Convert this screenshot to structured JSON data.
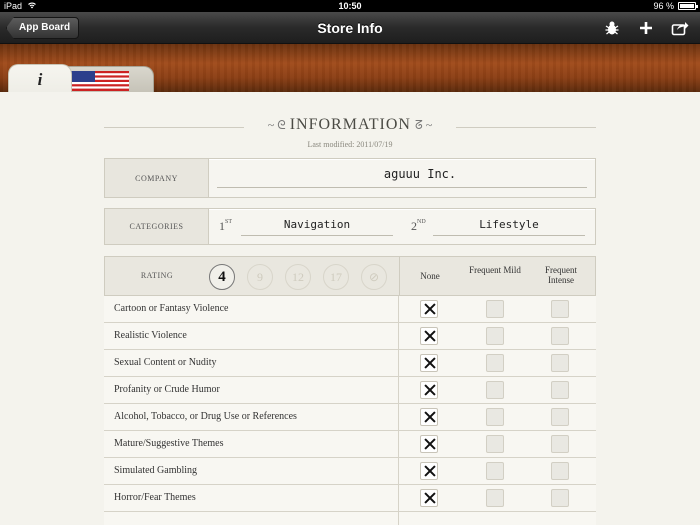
{
  "status_bar": {
    "device": "iPad",
    "time": "10:50",
    "battery": "96 %"
  },
  "nav": {
    "back_label": "App Board",
    "title": "Store Info",
    "icons": [
      "bug-icon",
      "plus-icon",
      "share-icon"
    ]
  },
  "tabs": [
    {
      "name": "info-tab",
      "label": "i",
      "selected": true
    },
    {
      "name": "us-flag-tab",
      "icon": "us-flag-icon",
      "selected": false
    }
  ],
  "header": {
    "title": "INFORMATION",
    "last_modified": "Last modified: 2011/07/19"
  },
  "company": {
    "label": "COMPANY",
    "value": "aguuu Inc."
  },
  "categories": {
    "label": "CATEGORIES",
    "first_num": "1",
    "first_sup": "ST",
    "first_value": "Navigation",
    "second_num": "2",
    "second_sup": "ND",
    "second_value": "Lifestyle"
  },
  "rating": {
    "label": "RATING",
    "badges": [
      "4",
      "9",
      "12",
      "17",
      "⊘"
    ],
    "selected": "4",
    "columns": {
      "none": "None",
      "mild": "Frequent Mild",
      "intense": "Frequent Intense"
    }
  },
  "content_rows": [
    {
      "label": "Cartoon or Fantasy Violence",
      "selection": "none"
    },
    {
      "label": "Realistic Violence",
      "selection": "none"
    },
    {
      "label": "Sexual Content or Nudity",
      "selection": "none"
    },
    {
      "label": "Profanity or Crude Humor",
      "selection": "none"
    },
    {
      "label": "Alcohol, Tobacco, or Drug Use or References",
      "selection": "none"
    },
    {
      "label": "Mature/Suggestive Themes",
      "selection": "none"
    },
    {
      "label": "Simulated Gambling",
      "selection": "none"
    },
    {
      "label": "Horror/Fear Themes",
      "selection": "none"
    }
  ],
  "colors": {
    "navbar": "#2a2a2a",
    "wood": "#a14c1c",
    "paper": "#f4f3ed"
  }
}
